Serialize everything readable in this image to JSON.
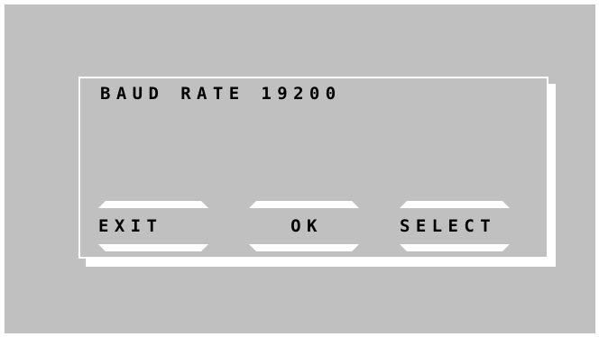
{
  "screen": {
    "title": "BAUD RATE 19200"
  },
  "softkeys": [
    {
      "label": "EXIT"
    },
    {
      "label": "OK"
    },
    {
      "label": "SELECT"
    }
  ],
  "colors": {
    "background": "#c0c0c0",
    "frame": "#ffffff",
    "text": "#000000"
  }
}
